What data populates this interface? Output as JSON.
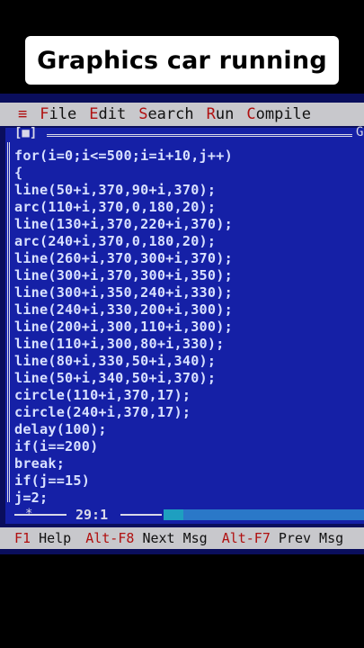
{
  "caption": "Graphics car running",
  "menu": {
    "system": "≡",
    "items": [
      {
        "hotkey": "F",
        "rest": "ile"
      },
      {
        "hotkey": "E",
        "rest": "dit"
      },
      {
        "hotkey": "S",
        "rest": "earch"
      },
      {
        "hotkey": "R",
        "rest": "un"
      },
      {
        "hotkey": "C",
        "rest": "ompile"
      }
    ]
  },
  "window": {
    "close_glyph": "[■]",
    "right_edge_char": "G"
  },
  "code": [
    "for(i=0;i<=500;i=i+10,j++)",
    "{",
    "line(50+i,370,90+i,370);",
    "arc(110+i,370,0,180,20);",
    "line(130+i,370,220+i,370);",
    "arc(240+i,370,0,180,20);",
    "line(260+i,370,300+i,370);",
    "line(300+i,370,300+i,350);",
    "line(300+i,350,240+i,330);",
    "line(240+i,330,200+i,300);",
    "line(200+i,300,110+i,300);",
    "line(110+i,300,80+i,330);",
    "line(80+i,330,50+i,340);",
    "line(50+i,340,50+i,370);",
    "circle(110+i,370,17);",
    "circle(240+i,370,17);",
    "delay(100);",
    "if(i==200)",
    "break;",
    "if(j==15)",
    "j=2;"
  ],
  "status": {
    "modified": "*",
    "position": "29:1"
  },
  "hints": [
    {
      "key": "F1",
      "label": "Help"
    },
    {
      "key": "Alt-F8",
      "label": "Next Msg"
    },
    {
      "key": "Alt-F7",
      "label": "Prev Msg"
    }
  ]
}
